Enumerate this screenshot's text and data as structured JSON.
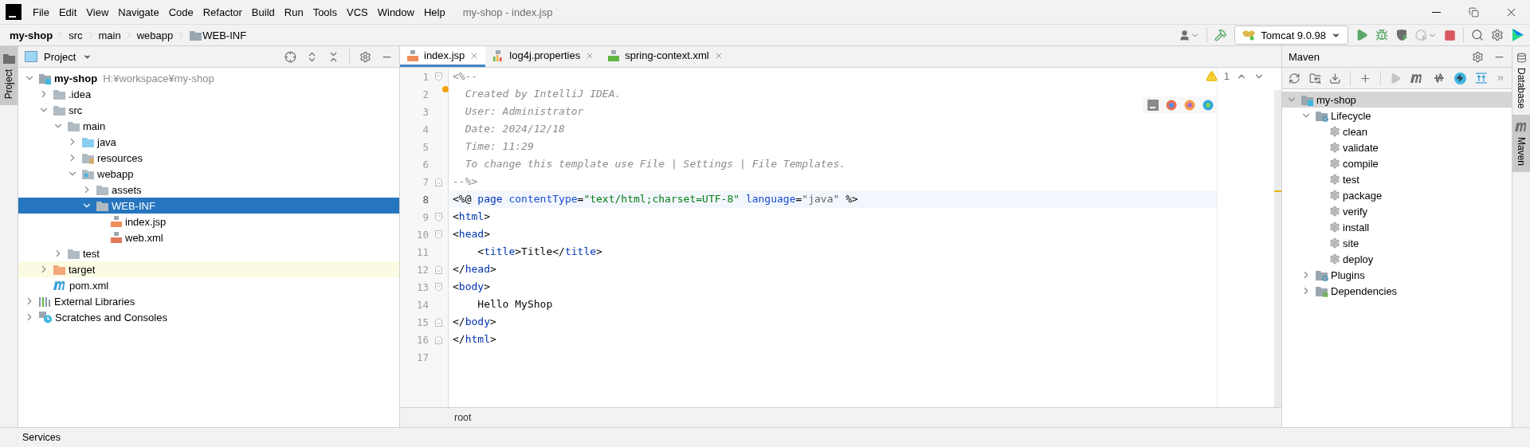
{
  "window": {
    "title": "my-shop - index.jsp"
  },
  "menu": [
    "File",
    "Edit",
    "View",
    "Navigate",
    "Code",
    "Refactor",
    "Build",
    "Run",
    "Tools",
    "VCS",
    "Window",
    "Help"
  ],
  "breadcrumbs": [
    {
      "label": "my-shop",
      "kind": "project"
    },
    {
      "label": "src",
      "kind": "plain"
    },
    {
      "label": "main",
      "kind": "plain"
    },
    {
      "label": "webapp",
      "kind": "plain"
    },
    {
      "label": "WEB-INF",
      "kind": "folder"
    }
  ],
  "run_config": {
    "label": "Tomcat 9.0.98"
  },
  "left_tabs": [
    {
      "label": "Project",
      "selected": true
    }
  ],
  "project_panel": {
    "title": "Project",
    "tree": [
      {
        "label": "my-shop",
        "kind": "module",
        "hint": "H:¥workspace¥my-shop",
        "expanded": true,
        "selected": false,
        "children": [
          {
            "label": ".idea",
            "kind": "folder",
            "expanded": false,
            "selected": false
          },
          {
            "label": "src",
            "kind": "folder",
            "expanded": true,
            "selected": false,
            "children": [
              {
                "label": "main",
                "kind": "folder",
                "expanded": true,
                "selected": false,
                "children": [
                  {
                    "label": "java",
                    "kind": "source",
                    "expanded": false,
                    "selected": false
                  },
                  {
                    "label": "resources",
                    "kind": "resources",
                    "expanded": false,
                    "selected": false
                  },
                  {
                    "label": "webapp",
                    "kind": "web",
                    "expanded": true,
                    "selected": false,
                    "children": [
                      {
                        "label": "assets",
                        "kind": "folder",
                        "expanded": false,
                        "selected": false
                      },
                      {
                        "label": "WEB-INF",
                        "kind": "folder",
                        "expanded": true,
                        "selected": true,
                        "children": [
                          {
                            "label": "index.jsp",
                            "kind": "jsp",
                            "selected": false
                          },
                          {
                            "label": "web.xml",
                            "kind": "webxml",
                            "selected": false
                          }
                        ]
                      }
                    ]
                  }
                ]
              },
              {
                "label": "test",
                "kind": "folder",
                "expanded": false,
                "selected": false
              }
            ]
          },
          {
            "label": "target",
            "kind": "excluded",
            "expanded": false,
            "selected": false
          },
          {
            "label": "pom.xml",
            "kind": "maven",
            "selected": false
          }
        ]
      },
      {
        "label": "External Libraries",
        "kind": "libraries",
        "expanded": false,
        "selected": false
      },
      {
        "label": "Scratches and Consoles",
        "kind": "scratches",
        "expanded": false,
        "selected": false
      }
    ]
  },
  "editor": {
    "tabs": [
      {
        "label": "index.jsp",
        "kind": "jsp",
        "selected": true
      },
      {
        "label": "log4j.properties",
        "kind": "properties",
        "selected": false
      },
      {
        "label": "spring-context.xml",
        "kind": "xml",
        "selected": false
      }
    ],
    "warning_count": "1",
    "lines": [
      {
        "number": "1",
        "kind": "fold-start",
        "current": false,
        "bulb": false,
        "tokens": [
          {
            "text": "<%--",
            "kind": "comment"
          }
        ]
      },
      {
        "number": "2",
        "kind": "plain",
        "current": false,
        "bulb": true,
        "tokens": [
          {
            "text": "  Created by IntelliJ IDEA.",
            "kind": "comment"
          }
        ]
      },
      {
        "number": "3",
        "kind": "plain",
        "current": false,
        "bulb": false,
        "tokens": [
          {
            "text": "  User: Administrator",
            "kind": "comment"
          }
        ]
      },
      {
        "number": "4",
        "kind": "plain",
        "current": false,
        "bulb": false,
        "tokens": [
          {
            "text": "  Date: 2024/12/18",
            "kind": "comment"
          }
        ]
      },
      {
        "number": "5",
        "kind": "plain",
        "current": false,
        "bulb": false,
        "tokens": [
          {
            "text": "  Time: 11:29",
            "kind": "comment"
          }
        ]
      },
      {
        "number": "6",
        "kind": "plain",
        "current": false,
        "bulb": false,
        "tokens": [
          {
            "text": "  To change this template use File | Settings | File Templates.",
            "kind": "comment"
          }
        ]
      },
      {
        "number": "7",
        "kind": "fold-end",
        "current": false,
        "bulb": false,
        "tokens": [
          {
            "text": "--%>",
            "kind": "comment"
          }
        ]
      },
      {
        "number": "8",
        "kind": "plain",
        "current": true,
        "bulb": false,
        "tokens": [
          {
            "text": "<%@ ",
            "kind": "plain"
          },
          {
            "text": "page ",
            "kind": "tag"
          },
          {
            "text": "contentType",
            "kind": "attr"
          },
          {
            "text": "=",
            "kind": "plain"
          },
          {
            "text": "\"text/html;charset=UTF-8\" ",
            "kind": "string"
          },
          {
            "text": "language",
            "kind": "attr"
          },
          {
            "text": "=",
            "kind": "plain"
          },
          {
            "text": "\"java\" ",
            "kind": "value"
          },
          {
            "text": "%>",
            "kind": "plain"
          }
        ]
      },
      {
        "number": "9",
        "kind": "fold-start",
        "current": false,
        "bulb": false,
        "tokens": [
          {
            "text": "<",
            "kind": "plain"
          },
          {
            "text": "html",
            "kind": "tag"
          },
          {
            "text": ">",
            "kind": "plain"
          }
        ]
      },
      {
        "number": "10",
        "kind": "fold-start",
        "current": false,
        "bulb": false,
        "tokens": [
          {
            "text": "<",
            "kind": "plain"
          },
          {
            "text": "head",
            "kind": "tag"
          },
          {
            "text": ">",
            "kind": "plain"
          }
        ]
      },
      {
        "number": "11",
        "kind": "plain",
        "current": false,
        "bulb": false,
        "tokens": [
          {
            "text": "    <",
            "kind": "plain"
          },
          {
            "text": "title",
            "kind": "tag"
          },
          {
            "text": ">Title</",
            "kind": "plain"
          },
          {
            "text": "title",
            "kind": "tag"
          },
          {
            "text": ">",
            "kind": "plain"
          }
        ]
      },
      {
        "number": "12",
        "kind": "fold-end",
        "current": false,
        "bulb": false,
        "tokens": [
          {
            "text": "</",
            "kind": "plain"
          },
          {
            "text": "head",
            "kind": "tag"
          },
          {
            "text": ">",
            "kind": "plain"
          }
        ]
      },
      {
        "number": "13",
        "kind": "fold-start",
        "current": false,
        "bulb": false,
        "tokens": [
          {
            "text": "<",
            "kind": "plain"
          },
          {
            "text": "body",
            "kind": "tag"
          },
          {
            "text": ">",
            "kind": "plain"
          }
        ]
      },
      {
        "number": "14",
        "kind": "plain",
        "current": false,
        "bulb": false,
        "tokens": [
          {
            "text": "    Hello MyShop",
            "kind": "plain"
          }
        ]
      },
      {
        "number": "15",
        "kind": "fold-end",
        "current": false,
        "bulb": false,
        "tokens": [
          {
            "text": "</",
            "kind": "plain"
          },
          {
            "text": "body",
            "kind": "tag"
          },
          {
            "text": ">",
            "kind": "plain"
          }
        ]
      },
      {
        "number": "16",
        "kind": "fold-end",
        "current": false,
        "bulb": false,
        "tokens": [
          {
            "text": "</",
            "kind": "plain"
          },
          {
            "text": "html",
            "kind": "tag"
          },
          {
            "text": ">",
            "kind": "plain"
          }
        ]
      },
      {
        "number": "17",
        "kind": "plain",
        "current": false,
        "bulb": false
      }
    ],
    "breadcrumb": "root"
  },
  "maven_panel": {
    "title": "Maven",
    "tree": [
      {
        "label": "my-shop",
        "kind": "module",
        "expanded": true,
        "selected": true,
        "children": [
          {
            "label": "Lifecycle",
            "kind": "lifecycle",
            "expanded": true,
            "selected": false,
            "children": [
              {
                "label": "clean",
                "kind": "goal",
                "selected": false
              },
              {
                "label": "validate",
                "kind": "goal",
                "selected": false
              },
              {
                "label": "compile",
                "kind": "goal",
                "selected": false
              },
              {
                "label": "test",
                "kind": "goal",
                "selected": false
              },
              {
                "label": "package",
                "kind": "goal",
                "selected": false
              },
              {
                "label": "verify",
                "kind": "goal",
                "selected": false
              },
              {
                "label": "install",
                "kind": "goal",
                "selected": false
              },
              {
                "label": "site",
                "kind": "goal",
                "selected": false
              },
              {
                "label": "deploy",
                "kind": "goal",
                "selected": false
              }
            ]
          },
          {
            "label": "Plugins",
            "kind": "lifecycle",
            "expanded": false,
            "selected": false
          },
          {
            "label": "Dependencies",
            "kind": "dependencies",
            "expanded": false,
            "selected": false
          }
        ]
      }
    ]
  },
  "right_tabs": [
    {
      "label": "Database",
      "kind": "database",
      "selected": false
    },
    {
      "label": "Maven",
      "kind": "maven",
      "selected": true
    }
  ],
  "status_bar": {
    "label": "Services"
  }
}
